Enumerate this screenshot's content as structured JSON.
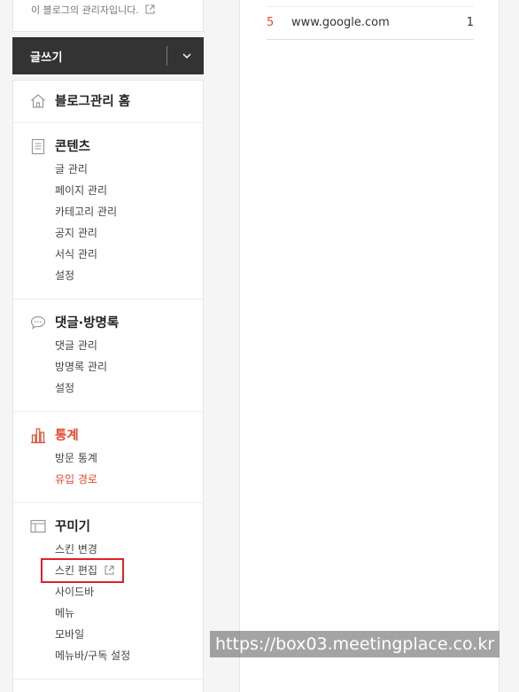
{
  "top_note": {
    "text": "이 블로그의 관리자입니다."
  },
  "write_bar": {
    "label": "글쓰기"
  },
  "menu": {
    "home": {
      "title": "블로그관리 홈"
    },
    "contents": {
      "title": "콘텐츠",
      "items": [
        "글 관리",
        "페이지 관리",
        "카테고리 관리",
        "공지 관리",
        "서식 관리",
        "설정"
      ]
    },
    "comments": {
      "title": "댓글·방명록",
      "items": [
        "댓글 관리",
        "방명록 관리",
        "설정"
      ]
    },
    "stats": {
      "title": "통계",
      "items": [
        "방문 통계",
        "유입 경로"
      ]
    },
    "decor": {
      "title": "꾸미기",
      "items": [
        "스킨 변경",
        "스킨 편집",
        "사이드바",
        "메뉴",
        "모바일",
        "메뉴바/구독 설정"
      ]
    }
  },
  "referrers": [
    {
      "rank": "5",
      "site": "www.google.com",
      "count": "1"
    }
  ],
  "watermark": {
    "text": "https://box03.meetingplace.co.kr"
  },
  "colors": {
    "accent": "#e4482e",
    "write_bar": "#333333",
    "highlight_box": "#e1202a"
  },
  "icons": {
    "home": "home-icon",
    "contents": "document-icon",
    "comments": "speech-bubble-icon",
    "stats": "bar-chart-icon",
    "decor": "layout-icon",
    "external": "external-link-icon",
    "dropdown": "chevron-down-icon"
  }
}
